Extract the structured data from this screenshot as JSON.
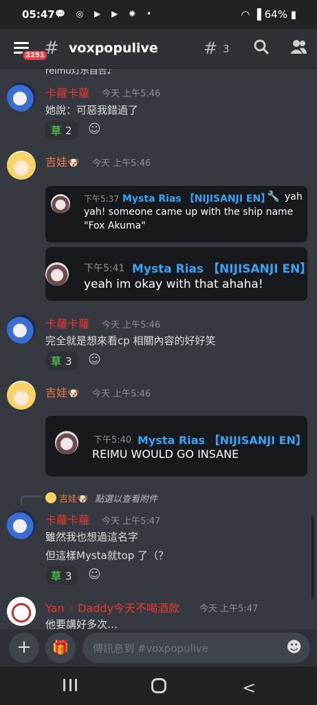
{
  "status": {
    "time": "05:47",
    "battery": "64%",
    "icons": "💬 ◎ ▶ ▶ ✺ •"
  },
  "header": {
    "badge": "2251",
    "channel": "voxpopulive",
    "thread_count": "3"
  },
  "messages": {
    "cut_text": "reimu灯乐自合♪",
    "m1": {
      "user": "卡蘿卡蘿",
      "time": "今天 上午5:46",
      "text": "她說：可惡我錯過了",
      "reaction_emoji": "草",
      "reaction_count": "2"
    },
    "m2": {
      "user": "吉娃",
      "dog": "🐶",
      "time": "今天 上午5:46",
      "embed1": {
        "time": "下午5:37",
        "author": "Mysta Rias 【NIJISANJI EN】",
        "tool_icon": "🔧",
        "line1": "yah",
        "line2": "yah! someone came up with the ship name",
        "line3": "\"Fox Akuma\""
      },
      "embed2": {
        "time": "下午5:41",
        "author": "Mysta Rias 【NIJISANJI EN】",
        "text": "yeah im okay with that ahaha!"
      }
    },
    "m3": {
      "user": "卡蘿卡蘿",
      "time": "今天 上午5:46",
      "text": "完全就是想來看cp 相關內容的好好笑",
      "reaction_emoji": "草",
      "reaction_count": "3"
    },
    "m4": {
      "user": "吉娃",
      "dog": "🐶",
      "time": "今天 上午5:46",
      "embed": {
        "time": "下午5:40",
        "author": "Mysta Rias 【NIJISANJI EN】",
        "text": "REIMU WOULD GO INSANE"
      }
    },
    "reply": {
      "name": "吉娃",
      "dog": "🐶",
      "text": "點選以查看附件"
    },
    "m5": {
      "user": "卡蘿卡蘿",
      "time": "今天 上午5:47",
      "line1": "雖然我也想過這名字",
      "line2": "但這樣Mysta就top 了（？",
      "reaction_emoji": "草",
      "reaction_count": "3"
    },
    "m6": {
      "user": "Yan ◦ Daddy今天不喝酒款",
      "time": "今天 上午5:47",
      "text": "他要講好多次…"
    }
  },
  "input": {
    "placeholder": "傳訊息到 #voxpopulive"
  },
  "colors": {
    "background": "#36393f",
    "link": "#3ba3f4",
    "red_name": "#e53935",
    "orange_name": "#e67e45",
    "reaction_green": "#4caf50"
  }
}
